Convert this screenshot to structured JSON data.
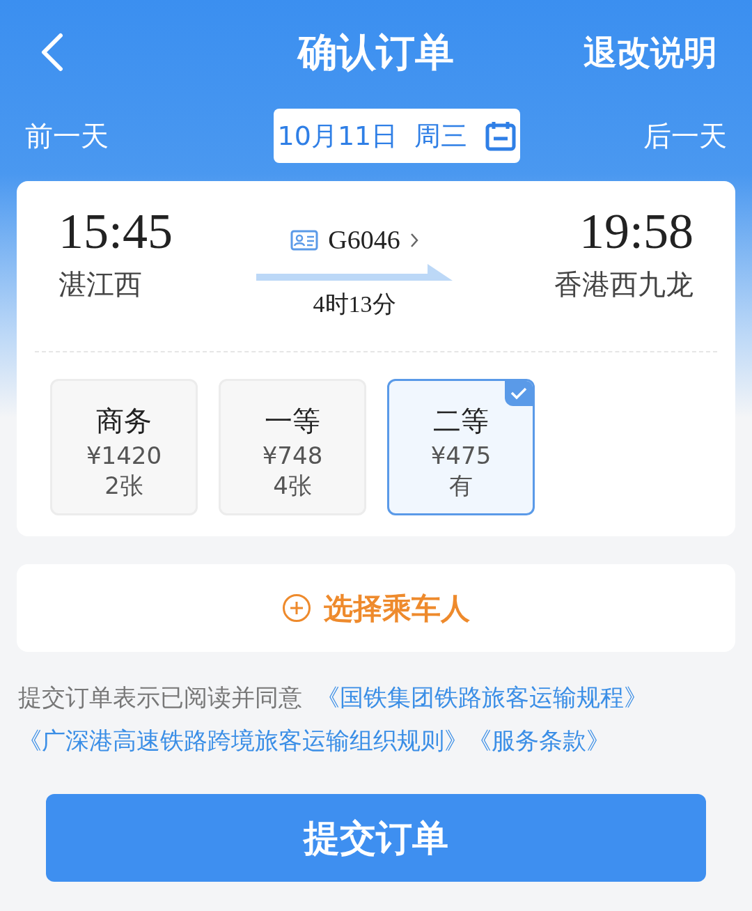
{
  "header": {
    "title": "确认订单",
    "action": "退改说明"
  },
  "date_bar": {
    "prev": "前一天",
    "date": "10月11日  周三",
    "next": "后一天"
  },
  "train": {
    "depart_time": "15:45",
    "depart_station": "湛江西",
    "number": "G6046",
    "duration": "4时13分",
    "arrive_time": "19:58",
    "arrive_station": "香港西九龙"
  },
  "seats": [
    {
      "class": "商务",
      "price": "¥1420",
      "availability": "2张",
      "selected": false
    },
    {
      "class": "一等",
      "price": "¥748",
      "availability": "4张",
      "selected": false
    },
    {
      "class": "二等",
      "price": "¥475",
      "availability": "有",
      "selected": true
    }
  ],
  "passenger_button": "选择乘车人",
  "agreement": {
    "text": "提交订单表示已阅读并同意",
    "links": [
      "《国铁集团铁路旅客运输规程》",
      "《广深港高速铁路跨境旅客运输组织规则》",
      "《服务条款》"
    ]
  },
  "submit": "提交订单"
}
